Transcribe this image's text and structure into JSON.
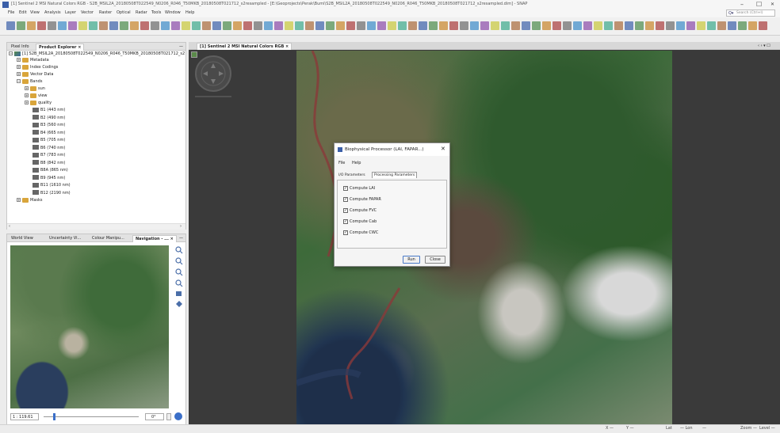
{
  "window": {
    "title": "[1] Sentinel 2 MSI Natural Colors RGB - S2B_MSIL2A_20180508T022549_N0206_R046_T50MKB_20180508T021712_s2resampled - [E:\\Geoprojects\\Perak\\Bumi\\S2B_MSIL2A_20180508T022549_N0206_R046_T50MKB_20180508T021712_s2resampled.dim] - SNAP",
    "minimize": "–",
    "maximize": "☐",
    "close": "✕"
  },
  "menu": [
    "File",
    "Edit",
    "View",
    "Analysis",
    "Layer",
    "Vector",
    "Raster",
    "Optical",
    "Radar",
    "Tools",
    "Window",
    "Help"
  ],
  "search": {
    "icon": "Q▾",
    "placeholder": "Search (Ctrl+I)"
  },
  "left_panel": {
    "tabs": [
      "Pixel Info",
      "Product Explorer ×"
    ],
    "minimize": "—",
    "product_label": "[1] S2B_MSIL2A_20180508T022549_N0206_R046_T50MKB_20180508T021712_s2",
    "nodes": {
      "metadata": "Metadata",
      "index_codings": "Index Codings",
      "vector_data": "Vector Data",
      "bands": "Bands",
      "sun": "sun",
      "view": "view",
      "quality": "quality",
      "masks": "Masks"
    },
    "bands": [
      "B1 (443 nm)",
      "B2 (490 nm)",
      "B3 (560 nm)",
      "B4 (665 nm)",
      "B5 (705 nm)",
      "B6 (740 nm)",
      "B7 (783 nm)",
      "B8 (842 nm)",
      "B8A (865 nm)",
      "B9 (945 nm)",
      "B11 (1610 nm)",
      "B12 (2190 nm)"
    ],
    "scroll_left": "‹",
    "scroll_right": "›"
  },
  "nav_panel": {
    "tabs": [
      "World View",
      "Uncertainty Vi...",
      "Colour Manipu...",
      "Navigation - ... ×"
    ],
    "minimize": "—",
    "scale": "1 : 119.61",
    "rotation": "0°"
  },
  "image_view": {
    "tab": "[1] Sentinel 2 MSI Natural Colors RGB ×",
    "right_controls": "‹ › ▾ ☐"
  },
  "dialog": {
    "title": "Biophysical Processor (LAI, FAPAR...)",
    "close": "✕",
    "menu": [
      "File",
      "Help"
    ],
    "tabs": [
      "I/O Parameters",
      "Processing Parameters"
    ],
    "options": [
      {
        "label": "Compute LAI",
        "checked": "✓"
      },
      {
        "label": "Compute FAPAR",
        "checked": "✓"
      },
      {
        "label": "Compute FVC",
        "checked": "✓"
      },
      {
        "label": "Compute Cab",
        "checked": "✓"
      },
      {
        "label": "Compute CWC",
        "checked": "✓"
      }
    ],
    "run": "Run",
    "close_button": "Close"
  },
  "status": {
    "x": "X —",
    "y": "Y —",
    "lat": "Lat",
    "lat_val": "— Lon",
    "lon_val": "—",
    "zoom": "Zoom —",
    "level": "Level —"
  },
  "colors": {
    "accent": "#3b5fa8",
    "background": "#ececec",
    "image_bg": "#3a3a3a"
  }
}
